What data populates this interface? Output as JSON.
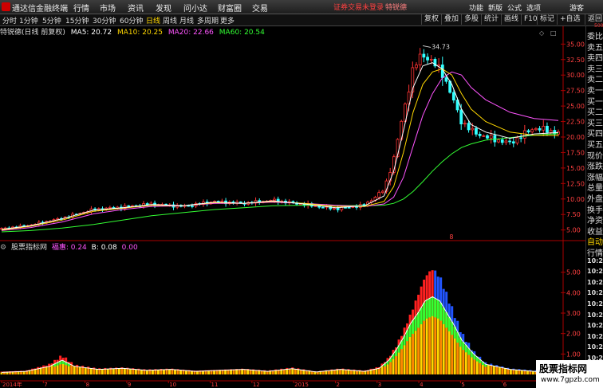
{
  "menubar": {
    "app_name": "通达信金融终端",
    "menus": [
      "行情",
      "市场",
      "资讯",
      "发现",
      "问小达",
      "财富圈",
      "交易"
    ],
    "status_text": "证券交易未登录",
    "stock_link": "特锐德",
    "right_menus": [
      "功能",
      "新版",
      "公式",
      "选项"
    ],
    "user": "游客"
  },
  "tabs": [
    "分时",
    "1分钟",
    "5分钟",
    "15分钟",
    "30分钟",
    "60分钟",
    "日线",
    "周线",
    "月线",
    "多周期",
    "更多"
  ],
  "active_tab": "日线",
  "right_buttons": [
    "复权",
    "叠加",
    "多股",
    "统计",
    "画线",
    "F10",
    "标记",
    "+自选",
    "返回"
  ],
  "ma_line": {
    "title": "特锐德(日线 前复权)",
    "items": [
      {
        "label": "MA5: 20.72",
        "color": "#ffffff"
      },
      {
        "label": "MA10: 20.25",
        "color": "#ffd700"
      },
      {
        "label": "MA20: 22.66",
        "color": "#ff55ff"
      },
      {
        "label": "MA60: 20.54",
        "color": "#33ff33"
      }
    ]
  },
  "indicator_line": {
    "title": "股票指标网",
    "items": [
      {
        "label": "福惠: 0.24",
        "color": "#ff55ff"
      },
      {
        "label": "B: 0.08",
        "color": "#ffffff"
      },
      {
        "label": "0.00",
        "color": "#ff55ff"
      }
    ]
  },
  "sidebar_top_num": "500",
  "sidebar_items": [
    "委比",
    "卖五",
    "卖四",
    "卖三",
    "卖二",
    "卖一",
    "买一",
    "买二",
    "买三",
    "买四",
    "买五",
    "现价",
    "涨跌",
    "涨幅",
    "总量",
    "外盘",
    "换手",
    "净资",
    "收益",
    "自动",
    "行情",
    "10:26",
    "10:26",
    "10:26",
    "10:26",
    "10:26",
    "10:26",
    "10:26",
    "10:26",
    "10:26",
    "10:26"
  ],
  "watermark": {
    "line1": "股票指标网",
    "line2": "www.7gpzb.com"
  },
  "peak_label": "34.73",
  "marker_label": "8",
  "colors": {
    "up": "#ff3333",
    "down": "#33ffff",
    "ma5": "#ffffff",
    "ma10": "#ffd700",
    "ma20": "#ff55ff",
    "ma60": "#33ff33",
    "axis": "#ff4040"
  },
  "chart_data": [
    {
      "type": "line",
      "name": "price",
      "y_ticks": [
        "35.00",
        "32.50",
        "30.00",
        "27.50",
        "25.00",
        "22.50",
        "20.00",
        "17.50",
        "15.00",
        "12.50",
        "10.00",
        "7.50",
        "5.00"
      ],
      "ylim": [
        3.8,
        36.2
      ],
      "x_labels": [
        "2014年",
        "7",
        "8",
        "9",
        "10",
        "11",
        "12",
        "2015",
        "2",
        "3",
        "4",
        "5",
        "6",
        "7"
      ],
      "x": [
        0,
        12,
        25,
        38,
        50,
        62,
        75,
        88,
        100,
        112,
        125,
        138,
        150,
        158,
        162,
        166,
        170,
        174,
        178,
        182,
        186,
        190,
        194,
        200,
        210,
        220,
        230
      ],
      "close": [
        5.2,
        5.8,
        6.9,
        8.3,
        8.7,
        9.2,
        8.8,
        9.6,
        9.3,
        9.8,
        9.1,
        8.4,
        9.0,
        11.5,
        16.5,
        24.0,
        31.0,
        33.5,
        32.0,
        30.5,
        26.5,
        22.5,
        21.0,
        20.0,
        19.0,
        21.5,
        20.7
      ],
      "ma5": [
        5.1,
        5.7,
        6.8,
        8.2,
        8.6,
        9.1,
        8.9,
        9.5,
        9.3,
        9.7,
        9.2,
        8.6,
        8.9,
        10.5,
        14.5,
        21.0,
        28.0,
        31.5,
        32.0,
        31.0,
        28.5,
        24.5,
        22.0,
        20.8,
        19.8,
        20.5,
        20.72
      ],
      "ma10": [
        5.0,
        5.6,
        6.6,
        8.0,
        8.5,
        9.0,
        8.9,
        9.4,
        9.3,
        9.6,
        9.3,
        8.8,
        8.8,
        9.6,
        12.0,
        17.5,
        24.0,
        28.5,
        30.5,
        31.0,
        30.0,
        27.0,
        24.5,
        22.5,
        20.8,
        20.3,
        20.25
      ],
      "ma20": [
        4.9,
        5.4,
        6.3,
        7.6,
        8.3,
        8.8,
        8.9,
        9.3,
        9.3,
        9.5,
        9.3,
        9.0,
        8.8,
        9.2,
        10.3,
        13.5,
        18.5,
        23.5,
        27.0,
        29.5,
        30.5,
        30.0,
        28.0,
        26.0,
        24.0,
        23.0,
        22.66
      ],
      "ma60": [
        4.7,
        4.9,
        5.3,
        5.9,
        6.6,
        7.3,
        7.8,
        8.3,
        8.6,
        8.9,
        9.0,
        9.0,
        8.9,
        9.0,
        9.3,
        10.0,
        11.2,
        12.8,
        14.5,
        16.0,
        17.3,
        18.3,
        18.9,
        19.5,
        19.9,
        20.3,
        20.54
      ],
      "peak": {
        "x": 174,
        "value": 34.73
      }
    },
    {
      "type": "bar",
      "name": "indicator",
      "y_ticks": [
        "5.00",
        "4.00",
        "3.00",
        "2.00",
        "1.00"
      ],
      "ylim": [
        0,
        6.0
      ],
      "x": [
        0,
        10,
        20,
        25,
        30,
        40,
        50,
        60,
        70,
        80,
        90,
        100,
        110,
        120,
        130,
        140,
        150,
        156,
        160,
        163,
        166,
        169,
        172,
        175,
        178,
        181,
        184,
        187,
        190,
        195,
        200,
        210,
        220,
        230
      ],
      "values": [
        0.15,
        0.2,
        0.55,
        1.0,
        0.5,
        0.3,
        0.35,
        0.25,
        0.3,
        0.2,
        0.25,
        0.3,
        0.2,
        0.35,
        0.15,
        0.3,
        0.2,
        0.4,
        0.9,
        1.5,
        2.3,
        3.2,
        4.2,
        5.2,
        5.6,
        5.2,
        4.2,
        3.2,
        2.2,
        1.2,
        0.6,
        0.3,
        0.2,
        0.24
      ],
      "b_values": [
        0.1,
        0.15,
        0.4,
        0.7,
        0.4,
        0.25,
        0.3,
        0.2,
        0.25,
        0.15,
        0.2,
        0.25,
        0.15,
        0.28,
        0.12,
        0.25,
        0.15,
        0.3,
        0.7,
        1.2,
        1.8,
        2.5,
        3.0,
        3.6,
        3.8,
        3.6,
        3.0,
        2.4,
        1.7,
        1.0,
        0.5,
        0.25,
        0.15,
        0.08
      ]
    }
  ]
}
